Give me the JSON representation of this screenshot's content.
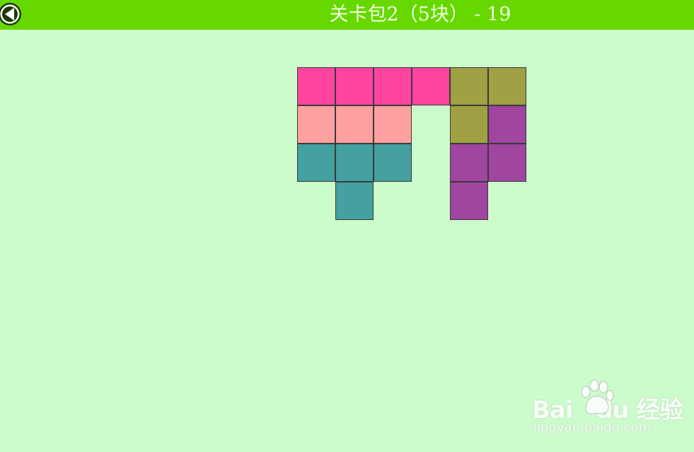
{
  "header": {
    "title": "关卡包2（5块） - 19",
    "back_icon": "back-arrow-icon",
    "bar_color": "#66d800"
  },
  "board": {
    "background": "#ccfccc",
    "pieces": [
      {
        "name": "pink-piece",
        "color": "#ff45a0",
        "cells": [
          [
            0,
            0
          ],
          [
            1,
            0
          ],
          [
            2,
            0
          ],
          [
            3,
            0
          ]
        ]
      },
      {
        "name": "olive-piece",
        "color": "#a0a045",
        "cells": [
          [
            4,
            0
          ],
          [
            5,
            0
          ],
          [
            4,
            1
          ]
        ]
      },
      {
        "name": "salmon-piece",
        "color": "#ffa0a0",
        "cells": [
          [
            0,
            1
          ],
          [
            1,
            1
          ],
          [
            2,
            1
          ]
        ]
      },
      {
        "name": "purple-piece",
        "color": "#a045a0",
        "cells": [
          [
            5,
            1
          ],
          [
            4,
            2
          ],
          [
            5,
            2
          ],
          [
            4,
            3
          ]
        ]
      },
      {
        "name": "teal-piece",
        "color": "#45a0a0",
        "cells": [
          [
            0,
            2
          ],
          [
            1,
            2
          ],
          [
            2,
            2
          ],
          [
            1,
            3
          ]
        ]
      }
    ]
  },
  "watermark": {
    "logo": "Bai du 经验",
    "url": "jingyan.baidu.com"
  }
}
